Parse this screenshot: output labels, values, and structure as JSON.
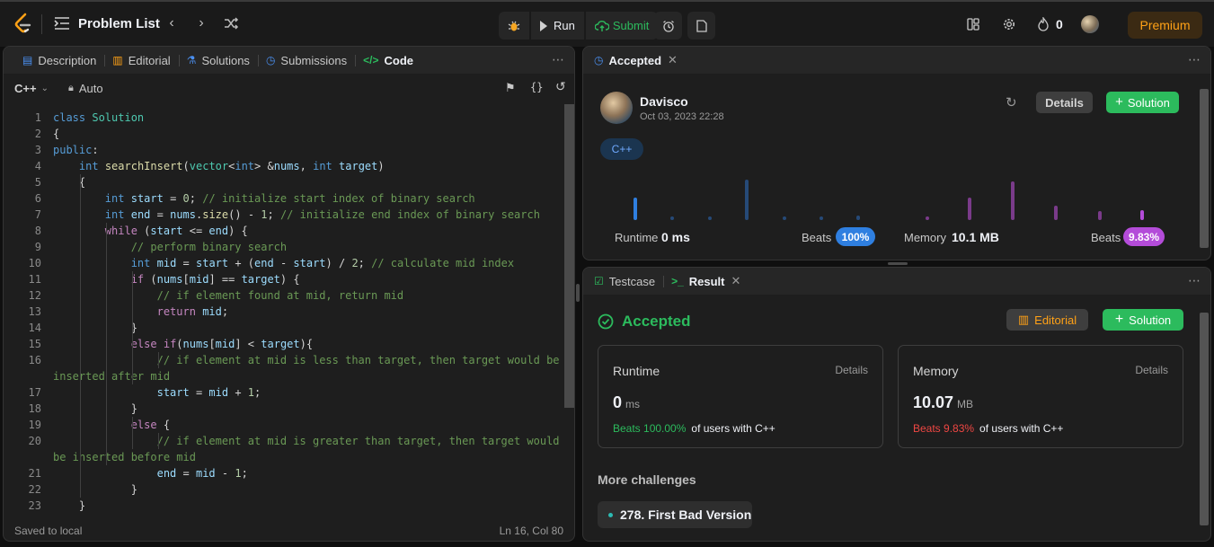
{
  "topbar": {
    "problem_list": "Problem List",
    "run": "Run",
    "submit": "Submit",
    "streak": "0",
    "premium": "Premium"
  },
  "left_panel": {
    "tabs": [
      {
        "label": "Description",
        "icon": "description-icon"
      },
      {
        "label": "Editorial",
        "icon": "book-icon"
      },
      {
        "label": "Solutions",
        "icon": "flask-icon"
      },
      {
        "label": "Submissions",
        "icon": "history-icon"
      },
      {
        "label": "Code",
        "icon": "code-icon"
      }
    ],
    "language": "C++",
    "mode": "Auto",
    "footer_left": "Saved to local",
    "footer_right": "Ln 16, Col 80"
  },
  "code_lines": [
    {
      "n": "1",
      "text": "class Solution"
    },
    {
      "n": "2",
      "text": "{"
    },
    {
      "n": "3",
      "text": "public:"
    },
    {
      "n": "4",
      "text": "    int searchInsert(vector<int> &nums, int target)"
    },
    {
      "n": "5",
      "text": "    {"
    },
    {
      "n": "6",
      "text": "        int start = 0; // initialize start index of binary search"
    },
    {
      "n": "7",
      "text": "        int end = nums.size() - 1; // initialize end index of binary search"
    },
    {
      "n": "8",
      "text": "        while (start <= end) {"
    },
    {
      "n": "9",
      "text": "            // perform binary search"
    },
    {
      "n": "10",
      "text": "            int mid = start + (end - start) / 2; // calculate mid index"
    },
    {
      "n": "11",
      "text": "            if (nums[mid] == target) {"
    },
    {
      "n": "12",
      "text": "                // if element found at mid, return mid"
    },
    {
      "n": "13",
      "text": "                return mid;"
    },
    {
      "n": "14",
      "text": "            }"
    },
    {
      "n": "15",
      "text": "            else if(nums[mid] < target){"
    },
    {
      "n": "16",
      "text": "                // if element at mid is less than target, then target would be"
    },
    {
      "n": "",
      "text": "inserted after mid"
    },
    {
      "n": "17",
      "text": "                start = mid + 1;"
    },
    {
      "n": "18",
      "text": "            }"
    },
    {
      "n": "19",
      "text": "            else {"
    },
    {
      "n": "20",
      "text": "                // if element at mid is greater than target, then target would"
    },
    {
      "n": "",
      "text": "be inserted before mid"
    },
    {
      "n": "21",
      "text": "                end = mid - 1;"
    },
    {
      "n": "22",
      "text": "            }"
    },
    {
      "n": "23",
      "text": "    }"
    }
  ],
  "accepted_panel": {
    "tab": "Accepted",
    "user": "Davisco",
    "date": "Oct 03, 2023 22:28",
    "details": "Details",
    "solution": "Solution",
    "language": "C++",
    "runtime_label": "Runtime",
    "runtime_value": "0 ms",
    "runtime_beats_label": "Beats",
    "runtime_beats": "100%",
    "memory_label": "Memory",
    "memory_value": "10.1 MB",
    "memory_beats_label": "Beats",
    "memory_beats": "9.83%",
    "runtime_distribution": [
      0.55,
      0.08,
      0.08,
      0.0,
      1.0,
      0.0,
      0.08,
      0.08,
      0.12
    ],
    "memory_distribution": [
      0.08,
      0.55,
      0.95,
      0.0,
      0.35,
      0.22,
      0.25
    ],
    "colors": {
      "runtime": "#2f7fe0",
      "runtime_dim": "#264a78",
      "memory": "#7a3b8a",
      "memory_hl": "#b44cd9",
      "accepted": "#2cbb5d"
    }
  },
  "result_panel": {
    "tabs": [
      {
        "label": "Testcase",
        "icon": "checkbox-icon"
      },
      {
        "label": "Result",
        "icon": "terminal-icon"
      }
    ],
    "status": "Accepted",
    "editorial": "Editorial",
    "solution": "Solution",
    "runtime": {
      "title": "Runtime",
      "details": "Details",
      "value": "0",
      "unit": "ms",
      "beats": "Beats 100.00%",
      "suffix": "of users with C++"
    },
    "memory": {
      "title": "Memory",
      "details": "Details",
      "value": "10.07",
      "unit": "MB",
      "beats": "Beats 9.83%",
      "suffix": "of users with C++"
    },
    "more_title": "More challenges",
    "challenge": "278. First Bad Version"
  }
}
